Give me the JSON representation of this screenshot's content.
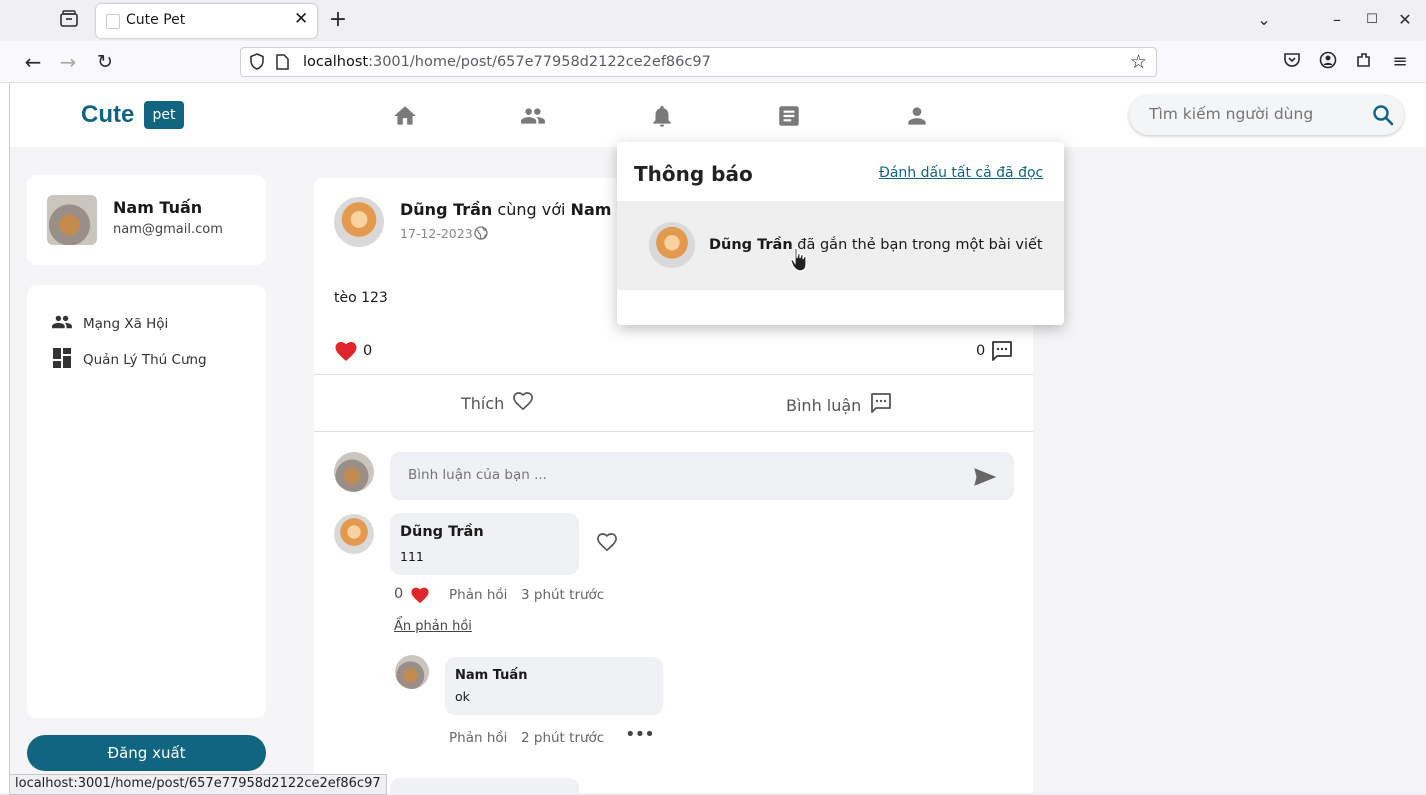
{
  "browser": {
    "tab_title": "Cute Pet",
    "url_host": "localhost",
    "url_path": ":3001/home/post/657e77958d2122ce2ef86c97",
    "status_url": "localhost:3001/home/post/657e77958d2122ce2ef86c97"
  },
  "header": {
    "logo": "Cute",
    "logo_badge": "pet",
    "search_placeholder": "Tìm kiếm người dùng"
  },
  "profile": {
    "name": "Nam Tuấn",
    "email": "nam@gmail.com"
  },
  "sidebar": {
    "items": [
      {
        "label": "Mạng Xã Hội",
        "icon": "people-icon"
      },
      {
        "label": "Quản Lý Thú Cưng",
        "icon": "dashboard-icon"
      }
    ],
    "logout": "Đăng xuất"
  },
  "post": {
    "author": "Dũng Trần",
    "with_text": "cùng với",
    "tagged": "Nam Tuấn",
    "date": "17-12-2023",
    "content": "tèo 123",
    "likes": "0",
    "comments": "0",
    "like_label": "Thích",
    "comment_label": "Bình luận",
    "comment_placeholder": "Bình luận của bạn ..."
  },
  "comments": [
    {
      "author": "Dũng Trần",
      "text": "111",
      "likes": "0",
      "reply_label": "Phản hồi",
      "time": "3 phút trước",
      "hide_replies": "Ẩn phản hồi",
      "replies": [
        {
          "author": "Nam Tuấn",
          "text": "ok",
          "reply_label": "Phản hồi",
          "time": "2 phút trước"
        }
      ]
    }
  ],
  "notifications": {
    "title": "Thông báo",
    "mark_all": "Đánh dấu tất cả đã đọc",
    "items": [
      {
        "actor": "Dũng Trần",
        "text": "đã gắn thẻ bạn trong một bài viết"
      }
    ]
  },
  "colors": {
    "brand": "#126580",
    "heart": "#e0262b"
  }
}
